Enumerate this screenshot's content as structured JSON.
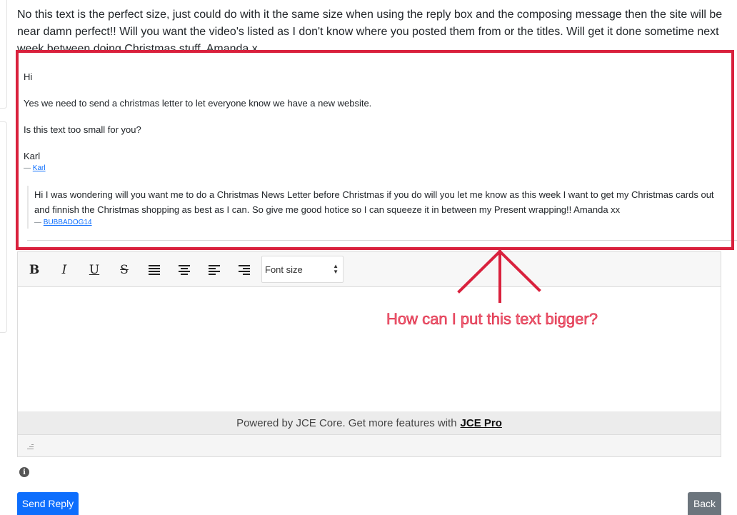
{
  "intro_text": "No this text is the perfect size, just could do with it the same size when using the reply box and the composing message then the site will be near damn perfect!! Will you want the video's listed as I don't know where you posted them from or the titles. Will get it done sometime next week between doing Christmas stuff. Amanda x",
  "quoted_message": {
    "greeting": "Hi",
    "line1": "Yes we need to send a christmas letter to let  everyone know we have a new website.",
    "line2": "Is this text too small for you?",
    "signoff": "Karl",
    "sig_dash": "—",
    "sig_author": "Karl",
    "nested": {
      "body": "Hi I was wondering will you want me to do a Christmas News Letter before Christmas if you do will you let me know as this week I want to get my Christmas cards out and finnish the Christmas shopping as best as I can. So give me good hotice so I can squeeze it in between my Present wrapping!! Amanda xx",
      "sig_dash": "—",
      "sig_author": "BUBBADOG14"
    }
  },
  "editor": {
    "toolbar": {
      "bold": "B",
      "italic": "I",
      "underline": "U",
      "strikethrough": "S",
      "font_size_label": "Font size"
    },
    "powered_text": "Powered by JCE Core. Get more features with",
    "powered_link": "JCE Pro"
  },
  "annotation": {
    "text": "How can I put this text bigger?",
    "color": "#d9213d"
  },
  "buttons": {
    "send_reply": "Send Reply",
    "back": "Back"
  },
  "colors": {
    "primary": "#0d6efd",
    "secondary": "#6c757d",
    "highlight": "#d9213d"
  }
}
